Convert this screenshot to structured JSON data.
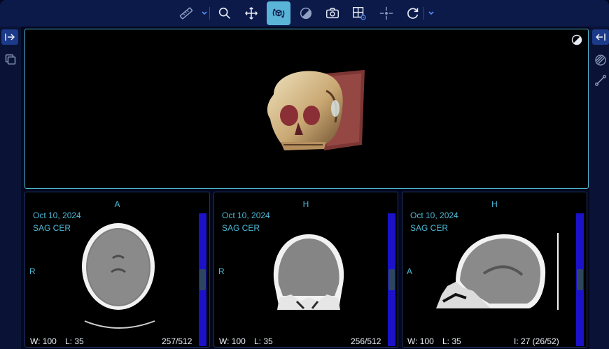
{
  "toolbar": {
    "tools": [
      {
        "name": "measure",
        "icon": "ruler-icon"
      },
      {
        "name": "zoom",
        "icon": "magnifier-icon"
      },
      {
        "name": "pan",
        "icon": "move-arrows-icon"
      },
      {
        "name": "rotate-3d",
        "icon": "rotate-cube-icon",
        "active": true
      },
      {
        "name": "window-level",
        "icon": "contrast-icon"
      },
      {
        "name": "capture",
        "icon": "camera-icon"
      },
      {
        "name": "layout",
        "icon": "layout-grid-icon"
      },
      {
        "name": "crosshairs",
        "icon": "crosshair-icon"
      },
      {
        "name": "reset",
        "icon": "reset-arrow-icon"
      }
    ]
  },
  "colors": {
    "accent": "#4db8d4",
    "active_tool": "#5ab4d8",
    "toolbar_bg": "#0c1a4a",
    "scrollbar": "#1a11c8"
  },
  "viewport_3d": {
    "render": "3D volume rendering of skull"
  },
  "viewports": [
    {
      "orientation_top": "A",
      "orientation_left": "R",
      "date": "Oct 10, 2024",
      "series": "SAG CER",
      "window": "W:  100",
      "level": "L:  35",
      "slice": "257/512",
      "scroll_fraction": 0.5
    },
    {
      "orientation_top": "H",
      "orientation_left": "R",
      "date": "Oct 10, 2024",
      "series": "SAG CER",
      "window": "W:  100",
      "level": "L:  35",
      "slice": "256/512",
      "scroll_fraction": 0.5
    },
    {
      "orientation_top": "H",
      "orientation_left": "A",
      "date": "Oct 10, 2024",
      "series": "SAG CER",
      "window": "W:  100",
      "level": "L:  35",
      "slice": "I: 27 (26/52)",
      "scroll_fraction": 0.5
    }
  ]
}
